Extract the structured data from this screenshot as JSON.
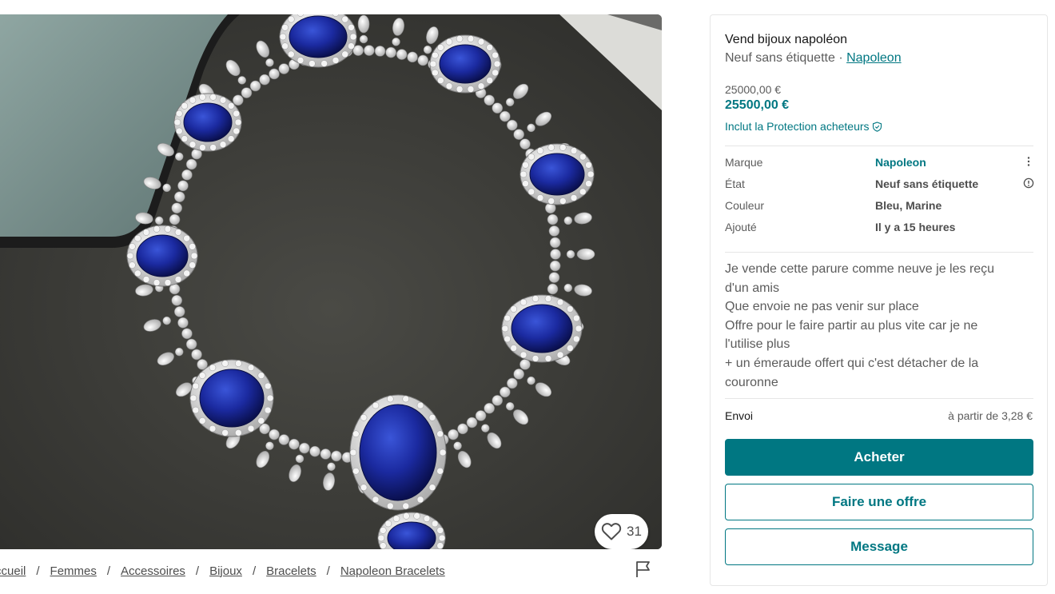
{
  "photo": {
    "alt": "",
    "likes": "31"
  },
  "breadcrumb": {
    "items": [
      "Accueil",
      "Femmes",
      "Accessoires",
      "Bijoux",
      "Bracelets",
      "Napoleon Bracelets"
    ],
    "separator": "/"
  },
  "item": {
    "title": "Vend bijoux napoléon",
    "condition": "Neuf sans étiquette",
    "subtitle_separator": " · ",
    "brand": "Napoleon",
    "price_original": "25000,00 €",
    "price_total": "25500,00 €",
    "protection_note": "Inclut la Protection acheteurs"
  },
  "details": [
    {
      "label": "Marque",
      "value": "Napoleon",
      "link": true,
      "icon": "more-vertical-icon"
    },
    {
      "label": "État",
      "value": "Neuf sans étiquette",
      "link": false,
      "icon": "info-icon"
    },
    {
      "label": "Couleur",
      "value": "Bleu, Marine",
      "link": false,
      "icon": ""
    },
    {
      "label": "Ajouté",
      "value": "Il y a 15 heures",
      "link": false,
      "icon": ""
    }
  ],
  "description_lines": [
    "Je vende cette parure comme neuve je les reçu",
    "d'un amis",
    "Que envoie ne pas venir sur place",
    "Offre pour le faire partir au plus vite car je ne",
    "l'utilise plus",
    "+ un émeraude offert qui c'est détacher de la",
    "couronne"
  ],
  "shipping": {
    "label": "Envoi",
    "value": "à partir de 3,28 €"
  },
  "actions": {
    "buy": "Acheter",
    "offer": "Faire une offre",
    "message": "Message"
  },
  "colors": {
    "accent": "#007782",
    "text": "#171717",
    "muted": "#5c5c5c",
    "border": "#e6e6e6"
  }
}
